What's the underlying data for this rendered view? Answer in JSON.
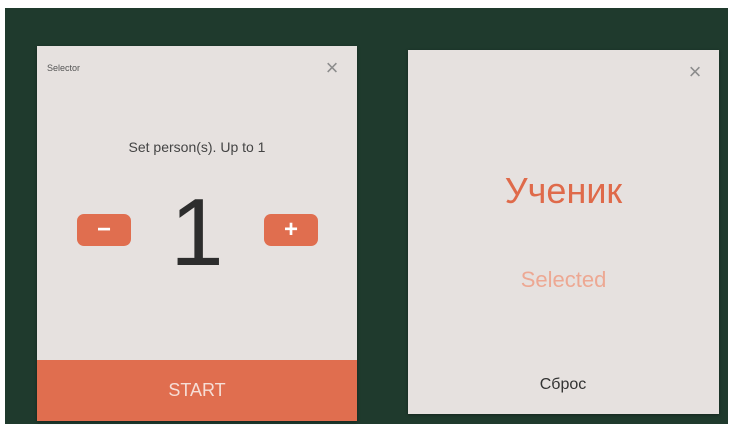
{
  "selector": {
    "title": "Selector",
    "close_icon": "close-icon",
    "instruction": "Set person(s). Up to 1",
    "decrement_symbol": "−",
    "increment_symbol": "+",
    "count": "1",
    "start_label": "START"
  },
  "result": {
    "close_icon": "close-icon",
    "name": "Ученик",
    "status": "Selected",
    "reset_label": "Сброс"
  },
  "colors": {
    "background": "#1f3a2d",
    "card": "#e6e1df",
    "accent": "#e06e4f",
    "accent_light": "#eda893",
    "text_dark": "#2d2d2d"
  }
}
